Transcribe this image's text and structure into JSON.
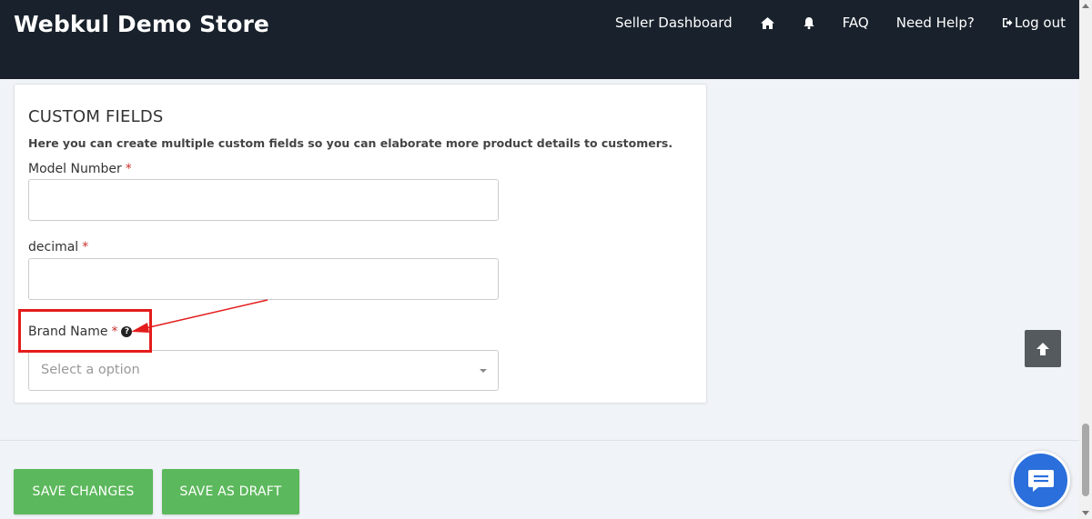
{
  "header": {
    "brand": "Webkul Demo Store",
    "nav": {
      "seller_dashboard": "Seller Dashboard",
      "faq": "FAQ",
      "need_help": "Need Help?",
      "logout": "Log out"
    }
  },
  "custom_fields": {
    "title": "CUSTOM FIELDS",
    "description": "Here you can create multiple custom fields so you can elaborate more product details to customers.",
    "fields": [
      {
        "label": "Model Number",
        "required": "*",
        "value": ""
      },
      {
        "label": "decimal",
        "required": "*",
        "value": ""
      },
      {
        "label": "Brand Name",
        "required": "*",
        "placeholder": "Select a option"
      }
    ]
  },
  "actions": {
    "save_changes": "SAVE CHANGES",
    "save_as_draft": "SAVE AS DRAFT"
  },
  "colors": {
    "navbar": "#19222c",
    "primary_button": "#5cb85c",
    "annotation": "#e41c1c",
    "chat": "#2a6fdb"
  },
  "icons": {
    "home": "home-icon",
    "notification": "bell-icon",
    "logout": "logout-icon",
    "help": "question-circle-icon",
    "scroll_top": "arrow-up-icon",
    "chat": "chat-icon"
  }
}
